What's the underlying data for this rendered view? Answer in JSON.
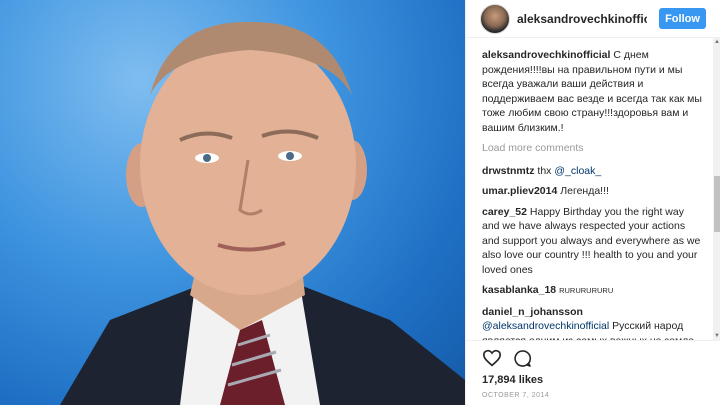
{
  "post": {
    "photo_subject": "portrait-photo"
  },
  "header": {
    "username": "aleksandrovechkinofficial",
    "follow_label": "Follow"
  },
  "caption": {
    "user": "aleksandrovechkinofficial",
    "text": "С днем рождения!!!!вы на правильном пути и мы всегда уважали ваши действия и поддерживаем вас везде и всегда так как мы тоже любим свою страну!!!здоровья вам и вашим близким.!"
  },
  "load_more_label": "Load more comments",
  "comments": [
    {
      "user": "drwstnmtz",
      "text": "thx ",
      "mention": "@_cloak_"
    },
    {
      "user": "umar.pliev2014",
      "text": "Легенда!!!"
    },
    {
      "user": "carey_52",
      "text": "Happy Birthday you the right way and we have always respected your actions and support you always and everywhere as we also love our country !!! health to you and your loved ones"
    },
    {
      "user": "kasablanka_18",
      "text": "RURURURURU"
    },
    {
      "user": "daniel_n_johansson",
      "mention": "@aleksandrovechkinofficial",
      "text": " Русский народ является одним из самых важных на земле, мы тебя любим!"
    }
  ],
  "actions": {
    "likes": "17,894 likes",
    "date": "OCTOBER 7, 2014"
  },
  "colors": {
    "follow_button": "#3897f0",
    "photo_background": "#3f95e0",
    "muted_text": "#999999"
  }
}
